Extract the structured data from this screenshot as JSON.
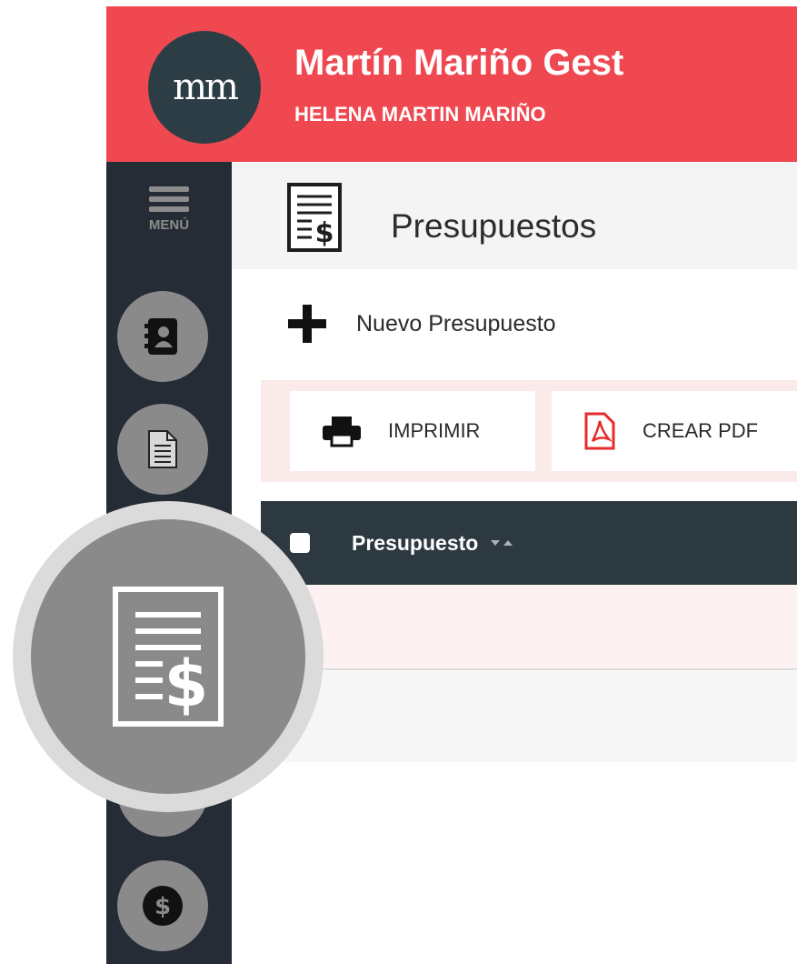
{
  "header": {
    "logo_text": "mm",
    "app_title": "Martín Mariño Gest",
    "user_name": "HELENA MARTIN MARIÑO"
  },
  "sidebar": {
    "menu_label": "MENÚ",
    "items": [
      {
        "icon": "address-book-icon"
      },
      {
        "icon": "document-icon"
      },
      {
        "icon": "budget-icon"
      },
      {
        "icon": "book-icon"
      },
      {
        "icon": "dollar-icon"
      }
    ]
  },
  "page": {
    "title": "Presupuestos",
    "title_icon": "budget-document-icon"
  },
  "actions": {
    "new_label": "Nuevo Presupuesto"
  },
  "toolbar": {
    "print_label": "IMPRIMIR",
    "pdf_label": "CREAR PDF"
  },
  "table": {
    "columns": [
      {
        "label": "Presupuesto"
      }
    ]
  },
  "colors": {
    "brand_red": "#ef4851",
    "sidebar_dark": "#252c36",
    "table_header": "#2d3940",
    "icon_gray": "#8a8a8a",
    "pdf_red": "#e52b2b"
  }
}
